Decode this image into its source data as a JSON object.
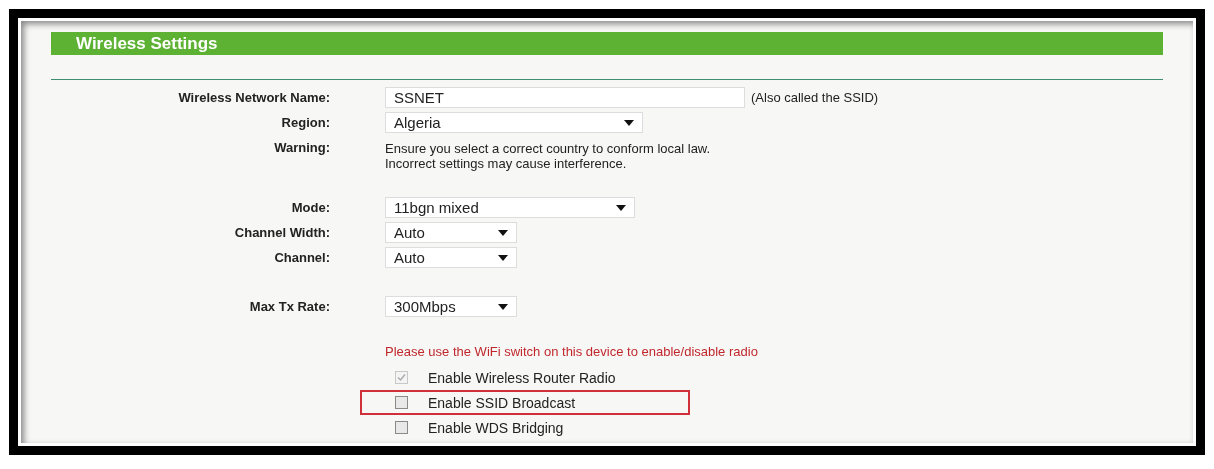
{
  "panel": {
    "title": "Wireless Settings"
  },
  "groups": [
    [
      {
        "kind": "text",
        "label": "Wireless Network Name:",
        "value": "SSNET",
        "note": "(Also called the SSID)"
      },
      {
        "kind": "select",
        "label": "Region:",
        "value": "Algeria"
      },
      {
        "kind": "message",
        "label": "Warning:",
        "lines": [
          "Ensure you select a correct country to conform local law.",
          "Incorrect settings may cause interference."
        ]
      }
    ],
    [
      {
        "kind": "select",
        "label": "Mode:",
        "value": "11bgn mixed"
      },
      {
        "kind": "select",
        "label": "Channel Width:",
        "value": "Auto"
      },
      {
        "kind": "select",
        "label": "Channel:",
        "value": "Auto"
      }
    ],
    [
      {
        "kind": "select",
        "label": "Max Tx Rate:",
        "value": "300Mbps"
      }
    ]
  ],
  "radio_notice": "Please use the WiFi switch on this device to enable/disable radio",
  "options": [
    {
      "label": "Enable Wireless Router Radio",
      "checked": true,
      "disabled": true,
      "highlighted": false
    },
    {
      "label": "Enable SSID Broadcast",
      "checked": false,
      "disabled": false,
      "highlighted": true
    },
    {
      "label": "Enable WDS Bridging",
      "checked": false,
      "disabled": false,
      "highlighted": false
    }
  ]
}
